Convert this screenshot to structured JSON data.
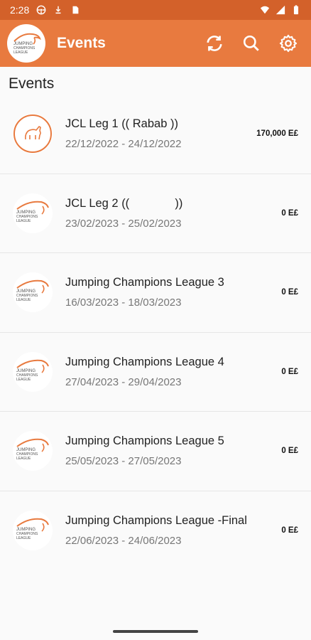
{
  "status_bar": {
    "time": "2:28",
    "icons": [
      "steering-wheel-icon",
      "download-icon",
      "sim-card-icon",
      "wifi-icon",
      "signal-icon",
      "battery-icon"
    ]
  },
  "app_bar": {
    "title": "Events",
    "logo_text": "JUMPING CHAMPIONS LEAGUE",
    "actions": [
      "refresh-icon",
      "search-icon",
      "gear-icon"
    ]
  },
  "section": {
    "title": "Events"
  },
  "events": [
    {
      "name": "JCL Leg 1 (( Rabab ))",
      "dates": "22/12/2022 - 24/12/2022",
      "price": "170,000 E£",
      "logo": "horse"
    },
    {
      "name": "JCL Leg 2 ((              ))",
      "dates": "23/02/2023 - 25/02/2023",
      "price": "0 E£",
      "logo": "jcl"
    },
    {
      "name": "Jumping Champions League 3",
      "dates": "16/03/2023 - 18/03/2023",
      "price": "0 E£",
      "logo": "jcl"
    },
    {
      "name": "Jumping Champions League 4",
      "dates": "27/04/2023 - 29/04/2023",
      "price": "0 E£",
      "logo": "jcl"
    },
    {
      "name": "Jumping Champions League 5",
      "dates": "25/05/2023 - 27/05/2023",
      "price": "0 E£",
      "logo": "jcl"
    },
    {
      "name": "Jumping Champions League -Final",
      "dates": "22/06/2023 - 24/06/2023",
      "price": "0 E£",
      "logo": "jcl"
    }
  ],
  "colors": {
    "status_bar": "#d3612a",
    "app_bar": "#e87a3f",
    "accent": "#e87a3f"
  }
}
